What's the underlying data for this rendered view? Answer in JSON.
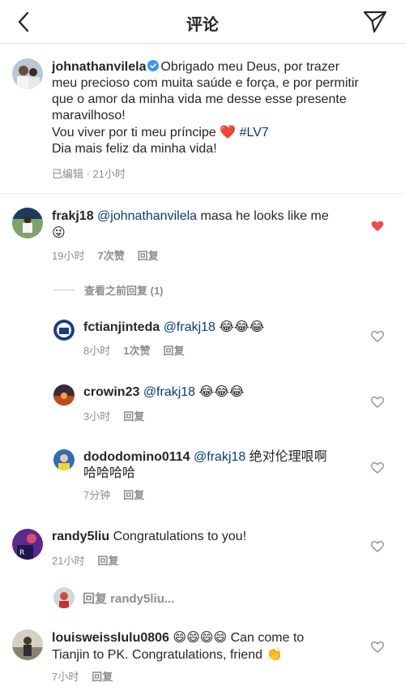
{
  "header": {
    "title": "评论"
  },
  "caption": {
    "username": "johnathanvilela",
    "line1": "Obrigado meu Deus, por trazer",
    "line2": "meu precioso com muita saúde e força, e por permitir",
    "line3": "que o amor da minha vida me desse esse presente",
    "line4": "maravilhoso!",
    "line5_text": "Vou viver por ti meu príncipe ",
    "line5_emoji": "❤️",
    "line5_tag": "#LV7",
    "line6": "Dia mais feliz da minha vida!",
    "meta": "已编辑 · 21小时"
  },
  "comments": [
    {
      "username": "frakj18",
      "mention": "@johnathanvilela",
      "text": " masa he looks like me",
      "emoji": "😜",
      "time": "19小时",
      "likes": "7次赞",
      "reply": "回复",
      "liked": true
    },
    {
      "username": "randy5liu",
      "text": "Congratulations to you!",
      "time": "21小时",
      "reply": "回复"
    },
    {
      "username": "louisweisslulu0806",
      "emoji": "😄😄😄😄",
      "text_line1": " Can come to",
      "text_line2": "Tianjin to PK. Congratulations, friend ",
      "emoji2": "👏",
      "time": "7小时",
      "reply": "回复"
    }
  ],
  "view_previous": "查看之前回复 (1)",
  "replies": [
    {
      "username": "fctianjinteda",
      "mention": "@frakj18",
      "emoji": "😂😂😂",
      "time": "8小时",
      "likes": "1次赞",
      "reply": "回复"
    },
    {
      "username": "crowin23",
      "mention": "@frakj18",
      "emoji": "😂😂😂",
      "time": "3小时",
      "reply": "回复"
    },
    {
      "username": "dododomino0114",
      "mention": "@frakj18",
      "text_line1": " 绝对伦理哏啊",
      "text_line2": "哈哈哈哈",
      "time": "7分钟",
      "reply": "回复"
    }
  ],
  "reply_bar": {
    "text": "回复 randy5liu..."
  },
  "colors": {
    "mention": "#0a3a7a",
    "heart_liked": "#ed4956",
    "meta": "#8e8e8e",
    "verified": "#3897f0"
  }
}
